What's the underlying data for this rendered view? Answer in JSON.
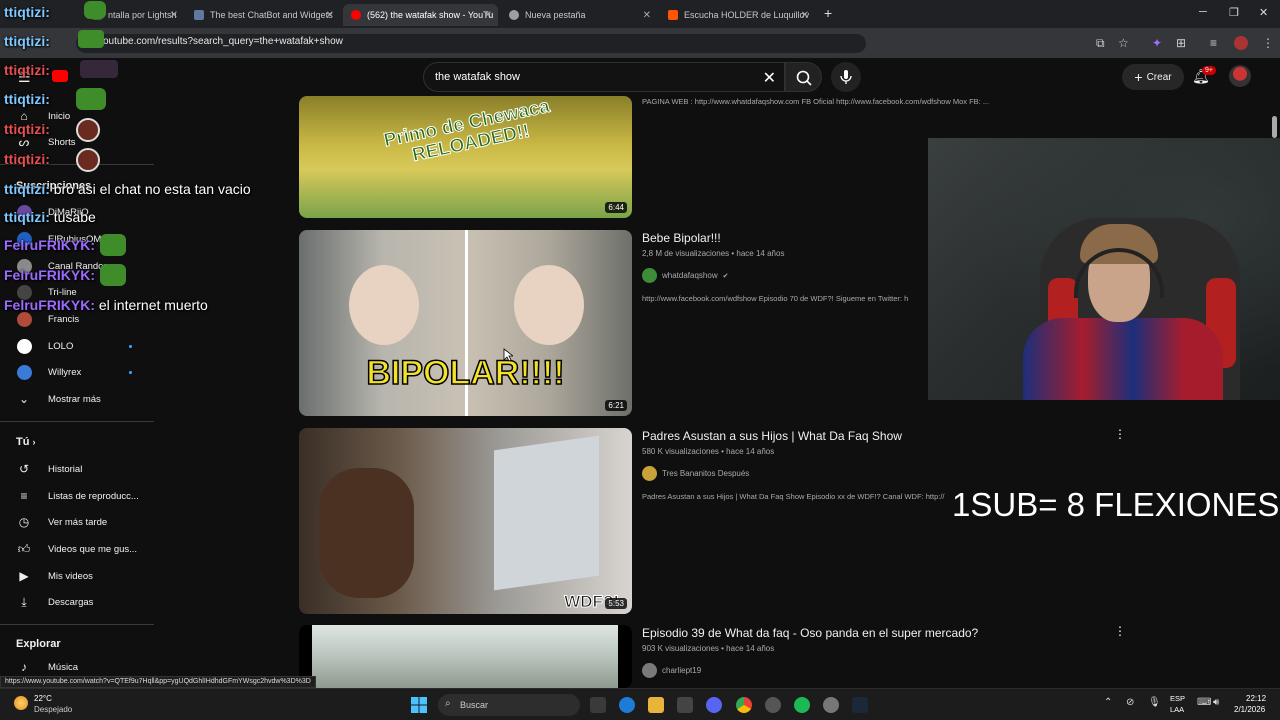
{
  "browser": {
    "tabs": [
      {
        "label": "ntalla por Lightsh",
        "fav_color": "#3b6e2f"
      },
      {
        "label": "The best ChatBot and Widgets",
        "fav_color": "#5f7a9e"
      },
      {
        "label": "(562) the watafak show - YouTu",
        "fav_color": "#ff0000"
      },
      {
        "label": "Nueva pestaña",
        "fav_color": "#9aa0a6"
      },
      {
        "label": "Escucha HOLDER de Luquillov",
        "fav_color": "#ff5500"
      }
    ],
    "new_tab_icon": "+",
    "url": "youtube.com/results?search_query=the+watafak+show"
  },
  "youtube": {
    "search_query": "the watafak show",
    "create_label": "Crear",
    "notif_badge": "9+",
    "sidebar": {
      "main": [
        {
          "label": "Inicio",
          "icon": "home-icon"
        },
        {
          "label": "Shorts",
          "icon": "shorts-icon"
        }
      ],
      "subs_title": "Suscripciones",
      "subs": [
        {
          "label": "DjMaRiiO",
          "color": "#6a4aa0",
          "dot": false
        },
        {
          "label": "ElRubiusOMG",
          "color": "#1e5fbf",
          "dot": false
        },
        {
          "label": "Canal Random",
          "color": "#8a8a8a",
          "dot": false
        },
        {
          "label": "Tri-line",
          "color": "#444",
          "dot": false
        },
        {
          "label": "Francis",
          "color": "#b04a3a",
          "dot": false
        },
        {
          "label": "LOLO",
          "color": "#ffffff",
          "dot": true
        },
        {
          "label": "Willyrex",
          "color": "#3a7ad9",
          "dot": true
        }
      ],
      "show_more": "Mostrar más",
      "you_title": "Tú",
      "you": [
        {
          "label": "Historial",
          "icon": "history-icon"
        },
        {
          "label": "Listas de reproducc...",
          "icon": "playlist-icon"
        },
        {
          "label": "Ver más tarde",
          "icon": "clock-icon"
        },
        {
          "label": "Videos que me gus...",
          "icon": "like-icon"
        },
        {
          "label": "Mis videos",
          "icon": "video-icon"
        },
        {
          "label": "Descargas",
          "icon": "download-icon"
        }
      ],
      "explore_title": "Explorar",
      "explore": [
        {
          "label": "Música",
          "icon": "music-icon"
        }
      ]
    },
    "results": [
      {
        "title": "",
        "meta": "",
        "channel": "",
        "desc": "PAGINA WEB : http://www.whatdafaqshow.com FB Oficial http://www.facebook.com/wdfshow Mox FB: ...",
        "duration": "6:44",
        "thumb_text": "Primo de Chewaca RELOADED!!"
      },
      {
        "title": "Bebe Bipolar!!!",
        "meta": "2,8 M de visualizaciones • hace 14 años",
        "channel": "whatdafaqshow",
        "desc": "http://www.facebook.com/wdfshow Episodio 70 de WDF?! Sigueme en Twitter: h",
        "duration": "6:21",
        "thumb_text": "BIPOLAR!!!!"
      },
      {
        "title": "Padres Asustan a sus Hijos | What Da Faq Show",
        "meta": "580 K visualizaciones • hace 14 años",
        "channel": "Tres Bananitos Después",
        "desc": "Padres Asustan a sus Hijos | What Da Faq Show Episodio xx de WDF!? Canal WDF: http://",
        "duration": "5:53",
        "thumb_text": "WDF?!"
      },
      {
        "title": "Episodio 39 de What da faq - Oso panda en el super mercado?",
        "meta": "903 K visualizaciones • hace 14 años",
        "channel": "charliept19",
        "desc": "",
        "duration": "",
        "thumb_text": ""
      }
    ]
  },
  "overlay": {
    "chat": [
      {
        "user": "ttiqtizi:",
        "text": "",
        "color": "#7ec8ff"
      },
      {
        "user": "ttiqtizi:",
        "text": "",
        "color": "#7ec8ff"
      },
      {
        "user": "ttiqtizi:",
        "text": "",
        "color": "#7ec8ff"
      },
      {
        "user": "ttiqtizi:",
        "text": "",
        "color": "#7ec8ff"
      },
      {
        "user": "ttiqtizi:",
        "text": "",
        "color": "#7ec8ff"
      },
      {
        "user": "ttiqtizi:",
        "text": "",
        "color": "#7ec8ff"
      },
      {
        "user": "ttiqtizi:",
        "text": "bro asi el chat no esta tan vacio",
        "color": "#7ec8ff"
      },
      {
        "user": "ttiqtizi:",
        "text": "tusabe",
        "color": "#7ec8ff"
      },
      {
        "user": "FelruFRIKYK:",
        "text": "",
        "color": "#9b6bff"
      },
      {
        "user": "FelruFRIKYK:",
        "text": "",
        "color": "#9b6bff"
      },
      {
        "user": "FelruFRIKYK:",
        "text": "el internet muerto",
        "color": "#9b6bff"
      }
    ],
    "sub_text": "1SUB= 8 FLEXIONES"
  },
  "status_link": "https://www.youtube.com/watch?v=QTEf9u7Hqll&pp=ygUQdGhlIHdhdGFmYWsgc2hvdw%3D%3D",
  "taskbar": {
    "weather_temp": "22°C",
    "weather_desc": "Despejado",
    "search_label": "Buscar",
    "lang": "ESP",
    "lang2": "LAA",
    "time": "22:12",
    "date": "2/1/2026"
  }
}
